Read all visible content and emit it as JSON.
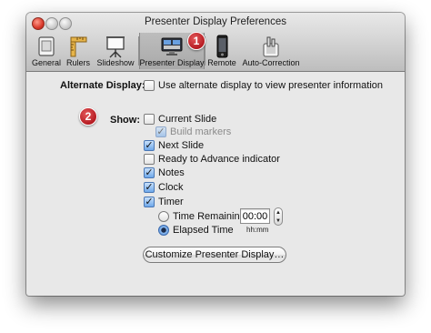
{
  "window": {
    "title": "Presenter Display Preferences"
  },
  "toolbar": {
    "items": [
      {
        "label": "General",
        "icon": "general-icon"
      },
      {
        "label": "Rulers",
        "icon": "rulers-icon"
      },
      {
        "label": "Slideshow",
        "icon": "slideshow-icon"
      },
      {
        "label": "Presenter Display",
        "icon": "presenter-display-icon",
        "selected": true
      },
      {
        "label": "Remote",
        "icon": "remote-icon"
      },
      {
        "label": "Auto-Correction",
        "icon": "auto-correction-icon"
      }
    ]
  },
  "callouts": {
    "one": "1",
    "two": "2"
  },
  "alternate_display": {
    "label": "Alternate Display:",
    "option": {
      "label": "Use alternate display to view presenter information",
      "checked": false
    }
  },
  "show": {
    "label": "Show:",
    "options": [
      {
        "label": "Current Slide",
        "checked": false
      },
      {
        "label": "Build markers",
        "checked": true,
        "disabled": true
      },
      {
        "label": "Next Slide",
        "checked": true
      },
      {
        "label": "Ready to Advance indicator",
        "checked": false
      },
      {
        "label": "Notes",
        "checked": true
      },
      {
        "label": "Clock",
        "checked": true
      },
      {
        "label": "Timer",
        "checked": true
      }
    ],
    "timer": {
      "time_remaining_label": "Time Remaining",
      "time_value": "00:00",
      "time_format": "hh:mm",
      "elapsed_time_label": "Elapsed Time",
      "selected": "Elapsed Time"
    }
  },
  "customize_button": "Customize Presenter Display…",
  "colors": {
    "callout": "#b51c22",
    "checkbox_checked": "#6ea8ea"
  }
}
